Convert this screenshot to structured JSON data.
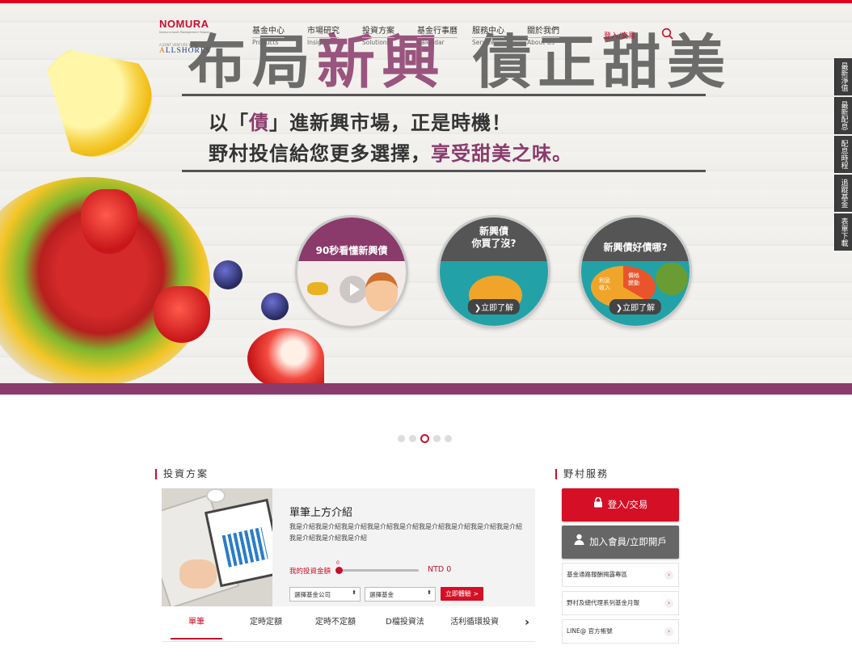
{
  "header": {
    "logo": {
      "brand": "NOMURA",
      "tagline": "Nomura Asset Management Taiwan",
      "partner_line": "A JOINT VENTURE WITH",
      "partner": "ALLSHORES"
    },
    "nav": [
      {
        "zh": "基金中心",
        "en": "Products"
      },
      {
        "zh": "市場研究",
        "en": "Insights"
      },
      {
        "zh": "投資方案",
        "en": "Solutions"
      },
      {
        "zh": "基金行事曆",
        "en": "Calendar"
      },
      {
        "zh": "服務中心",
        "en": "Service"
      },
      {
        "zh": "關於我們",
        "en": "About Us"
      }
    ],
    "login": "登入/交易",
    "search_icon": "search-icon"
  },
  "hero": {
    "title_part1": "布局",
    "title_part2": "新興",
    "title_part3": "債正甜美",
    "line1_a": "以「",
    "line1_b": "債",
    "line1_c": "」進新興市場，正是時機！",
    "line2_a": "野村投信給您更多選擇，",
    "line2_b": "享受甜美之味。",
    "circles": [
      {
        "title": "90秒看懂新興債",
        "cta": "",
        "color": "#8a3a6b"
      },
      {
        "title": "新興債\n你買了沒?",
        "cta": "❯立即了解",
        "color": "#555555"
      },
      {
        "title": "新興債好債哪?",
        "cta": "❯立即了解",
        "color": "#555555"
      }
    ],
    "pie_labels": {
      "a": "利息收入",
      "b": "價格變動"
    }
  },
  "side_tabs": [
    "最新淨值",
    "最新配息",
    "配息時程",
    "追蹤基金",
    "表單下載"
  ],
  "carousel": {
    "count": 5,
    "active": 3
  },
  "solutions": {
    "heading": "投資方案",
    "card_title": "單筆上方介紹",
    "card_desc": "我是介紹我是介紹我是介紹我是介紹我是介紹我是介紹我是介紹我是介紹我是介紹我是介紹我是介紹我是介紹",
    "amount_label": "我的投資金額",
    "slider_zero": "0",
    "amount_value": "NTD 0",
    "select_company": "選擇基金公司",
    "select_fund": "選擇基金",
    "try_button": "立即體驗 >",
    "tabs": [
      "單筆",
      "定時定額",
      "定時不定額",
      "D檔投資法",
      "活利循環投資"
    ],
    "active_tab": 0
  },
  "services": {
    "heading": "野村服務",
    "login_button": "登入/交易",
    "register_button": "加入會員/立即開戶",
    "links": [
      "基金通路報酬揭露專區",
      "野村及總代理系列基金月報",
      "LINE@ 官方帳號"
    ]
  },
  "colors": {
    "brand_red": "#c8102e",
    "accent_purple": "#8a3a6b",
    "dark_gray": "#666666"
  }
}
